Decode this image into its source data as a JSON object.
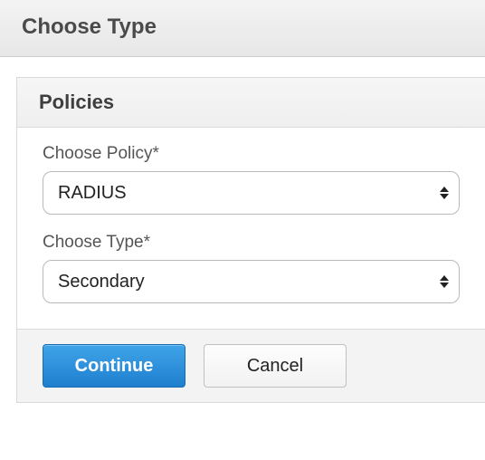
{
  "header": {
    "title": "Choose Type"
  },
  "panel": {
    "title": "Policies",
    "fields": {
      "policy": {
        "label": "Choose Policy*",
        "value": "RADIUS"
      },
      "type": {
        "label": "Choose Type*",
        "value": "Secondary"
      }
    }
  },
  "buttons": {
    "continue": "Continue",
    "cancel": "Cancel"
  }
}
